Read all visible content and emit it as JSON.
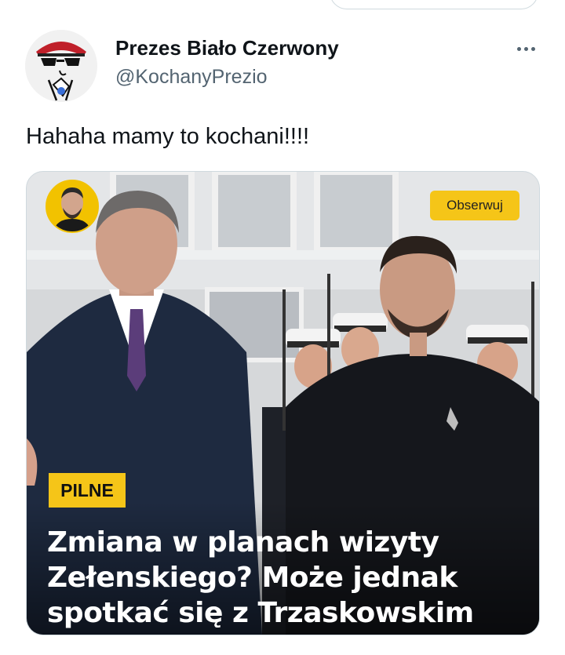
{
  "post": {
    "display_name": "Prezes Biało Czerwony",
    "handle": "@KochanyPrezio",
    "text": "Hahaha mamy to kochani!!!!",
    "more_icon": "more-horizontal-icon"
  },
  "media": {
    "follow_label": "Obserwuj",
    "tag": "PILNE",
    "headline_lines": [
      "Zmiana w planach wizyty",
      "Zełenskiego? Może jednak",
      "spotkać się z Trzaskowskim"
    ],
    "colors": {
      "accent_yellow": "#f5c518",
      "headline_text": "#ffffff"
    }
  }
}
